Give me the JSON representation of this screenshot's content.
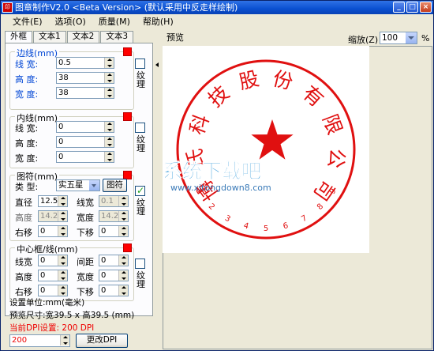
{
  "window": {
    "title": "图章制作V2.0 <Beta Version> (默认采用中反走样绘制)",
    "icon": "stamp-app-icon",
    "controls": [
      "minimize-icon",
      "maximize-icon",
      "close-icon"
    ]
  },
  "menu": [
    {
      "label": "文件(E)"
    },
    {
      "label": "选项(O)"
    },
    {
      "label": "质量(M)"
    },
    {
      "label": "帮助(H)"
    }
  ],
  "tabs": [
    {
      "label": "外框",
      "active": true
    },
    {
      "label": "文本1",
      "active": false
    },
    {
      "label": "文本2",
      "active": false
    },
    {
      "label": "文本3",
      "active": false
    }
  ],
  "border_group": {
    "title": "边线(mm)",
    "color": "#ff0000",
    "texture_label": "纹理",
    "texture_checked": false,
    "fields": [
      {
        "label": "线  宽:",
        "value": "0.5"
      },
      {
        "label": "高  度:",
        "value": "38"
      },
      {
        "label": "宽  度:",
        "value": "38"
      }
    ]
  },
  "inner_group": {
    "title": "内线(mm)",
    "color": "#ff0000",
    "texture_label": "纹理",
    "texture_checked": false,
    "fields": [
      {
        "label": "线  宽:",
        "value": "0"
      },
      {
        "label": "高  度:",
        "value": "0"
      },
      {
        "label": "宽  度:",
        "value": "0"
      }
    ]
  },
  "symbol_group": {
    "title": "图符(mm)",
    "color": "#ff0000",
    "type_label": "类  型:",
    "type_value": "实五星",
    "symbol_button": "图符",
    "texture_label": "纹理",
    "texture_checked": true,
    "diameter_label": "直径",
    "diameter_value": "12.5",
    "linewidth_label": "线宽",
    "linewidth_value": "0.1",
    "height_label": "高度",
    "height_value": "14.2",
    "width_label": "宽度",
    "width_value": "14.2",
    "right_label": "右移",
    "right_value": "0",
    "down_label": "下移",
    "down_value": "0"
  },
  "center_group": {
    "title": "中心框/线(mm)",
    "color": "#ff0000",
    "texture_label": "纹理",
    "texture_checked": false,
    "linewidth_label": "线宽",
    "linewidth_value": "0",
    "spacing_label": "间距",
    "spacing_value": "0",
    "height_label": "高度",
    "height_value": "0",
    "width_label": "宽度",
    "width_value": "0",
    "right_label": "右移",
    "right_value": "0",
    "down_label": "下移",
    "down_value": "0"
  },
  "status": {
    "unit": "设置单位:mm(毫米)",
    "preview_size": "预览尺寸:宽39.5 x 高39.5 (mm)",
    "dpi_label": "当前DPI设置: 200 DPI",
    "dpi_value": "200",
    "dpi_button": "更改DPI"
  },
  "preview": {
    "title": "预览",
    "zoom_label": "缩放(Z)",
    "zoom_value": "100",
    "zoom_unit": "%",
    "stamp_color": "#e01010",
    "stamp_text_chars": [
      "博",
      "氏",
      "科",
      "技",
      "股",
      "份",
      "有",
      "限",
      "公",
      "司"
    ],
    "stamp_numbers": [
      "1",
      "2",
      "3",
      "4",
      "5",
      "6",
      "7",
      "8",
      "9"
    ],
    "watermark_title": "系统下载吧",
    "watermark_url": "www.xitongdown8.com"
  }
}
